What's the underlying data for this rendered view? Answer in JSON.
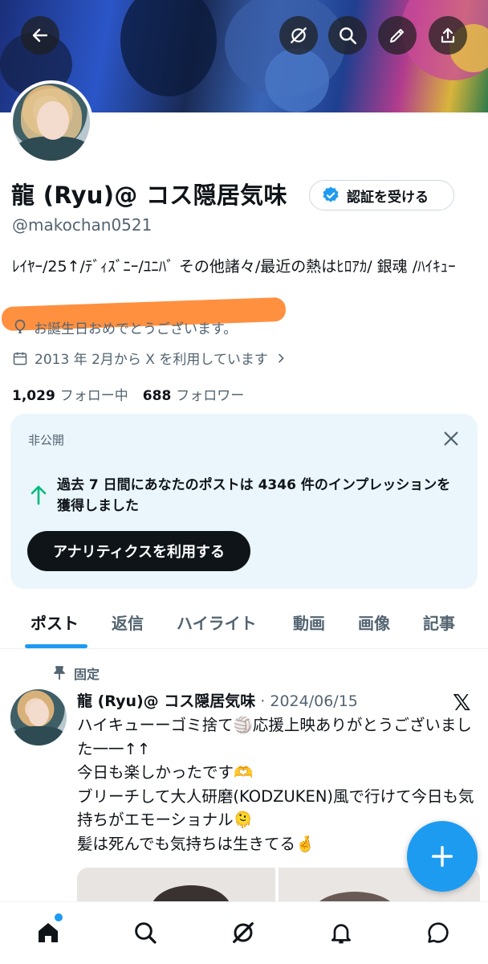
{
  "colors": {
    "accent": "#1d9bf0",
    "text": "#0f1419",
    "secondary": "#536471",
    "card_bg": "#eaf6fc",
    "highlight": "#ff7d1e"
  },
  "profile": {
    "name": "龍 (Ryu)@ コス隠居気味",
    "verify_button": "認証を受ける",
    "handle": "@makochan0521",
    "bio": "ﾚｲﾔｰ/25↑/ﾃﾞｨｽﾞﾆｰ/ﾕﾆﾊﾞ その他諸々/最近の熱はﾋﾛｱｶ/ 銀魂 /ﾊｲｷｭｰ",
    "birthday": "お誕生日おめでとうございます。",
    "joined": "2013 年 2月から X を利用しています",
    "following_count": "1,029",
    "following_label": "フォロー中",
    "followers_count": "688",
    "followers_label": "フォロワー"
  },
  "analytics_card": {
    "label": "非公開",
    "message": "過去 7 日間にあなたのポストは 4346 件のインプレッションを獲得しました",
    "button": "アナリティクスを利用する"
  },
  "tabs": [
    {
      "label": "ポスト",
      "active": true
    },
    {
      "label": "返信"
    },
    {
      "label": "ハイライト"
    },
    {
      "label": "動画"
    },
    {
      "label": "画像"
    },
    {
      "label": "記事"
    }
  ],
  "post": {
    "pinned_label": "固定",
    "author": "龍 (Ryu)@ コス隠居気味",
    "date": "· 2024/06/15",
    "text_lines": [
      "ハイキューーゴミ捨て🏐応援上映ありがとうございました一一↑↑",
      "今日も楽しかったです🫶",
      "ブリーチして大人研磨(KODZUKEN)風で行けて今日も気持ちがエモーショナル🫠",
      "髪は死んでも気持ちは生きてる🤞"
    ]
  },
  "icons": {
    "banner": [
      "back-arrow-icon",
      "grok-icon",
      "search-icon",
      "edit-pencil-icon",
      "share-icon"
    ],
    "nav": [
      "home-icon",
      "search-icon",
      "grok-icon",
      "bell-icon",
      "messages-icon"
    ]
  }
}
